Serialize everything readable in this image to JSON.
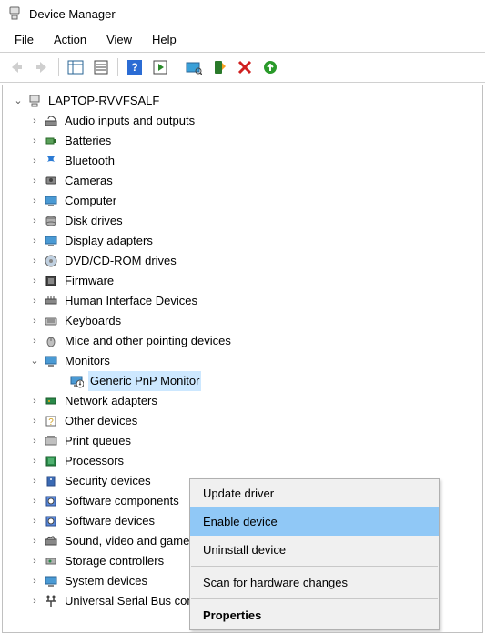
{
  "window": {
    "title": "Device Manager"
  },
  "menubar": {
    "items": [
      "File",
      "Action",
      "View",
      "Help"
    ]
  },
  "tree": {
    "root": "LAPTOP-RVVFSALF",
    "categories": [
      "Audio inputs and outputs",
      "Batteries",
      "Bluetooth",
      "Cameras",
      "Computer",
      "Disk drives",
      "Display adapters",
      "DVD/CD-ROM drives",
      "Firmware",
      "Human Interface Devices",
      "Keyboards",
      "Mice and other pointing devices",
      "Monitors",
      "Network adapters",
      "Other devices",
      "Print queues",
      "Processors",
      "Security devices",
      "Software components",
      "Software devices",
      "Sound, video and game controllers",
      "Storage controllers",
      "System devices",
      "Universal Serial Bus controllers"
    ],
    "expanded_category_index": 12,
    "child_of_monitors": "Generic PnP Monitor"
  },
  "context_menu": {
    "items": [
      "Update driver",
      "Enable device",
      "Uninstall device",
      "Scan for hardware changes",
      "Properties"
    ],
    "highlight_index": 1,
    "default_index": 4
  }
}
